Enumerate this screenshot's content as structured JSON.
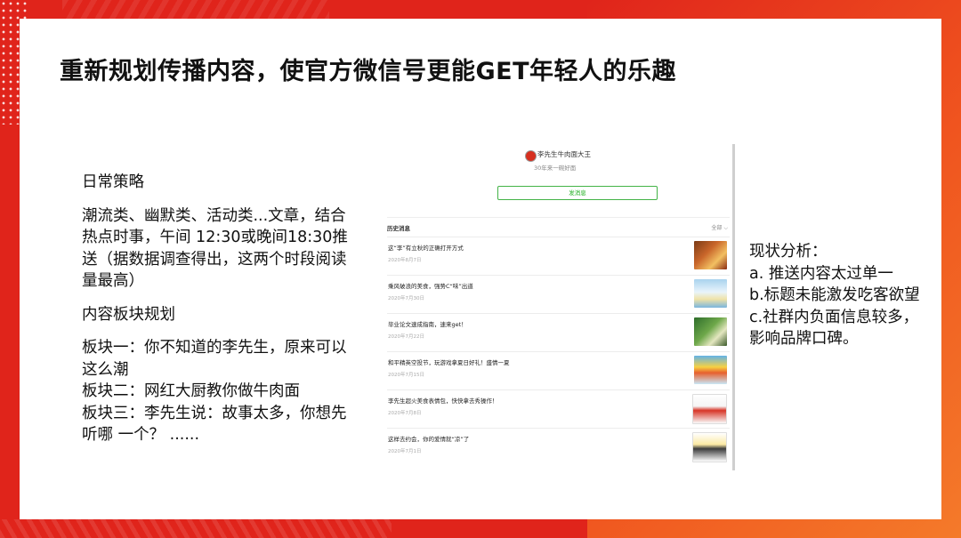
{
  "slide": {
    "title": "重新规划传播内容，使官方微信号更能GET年轻人的乐趣",
    "left": {
      "heading1": "日常策略",
      "para1": "潮流类、幽默类、活动类...文章，结合热点时事，午间 12:30或晚间18:30推送（据数据调查得出，这两个时段阅读量最高）",
      "heading2": "内容板块规划",
      "block1": "板块一：你不知道的李先生，原来可以这么潮",
      "block2": "板块二：网红大厨教你做牛肉面",
      "block3": "板块三：李先生说：故事太多，你想先听哪 一个？ ......"
    },
    "right": {
      "heading": "现状分析：",
      "item_a": "a. 推送内容太过单一",
      "item_b": "b.标题未能激发吃客欲望",
      "item_c": "c.社群内负面信息较多， 影响品牌口碑。"
    }
  },
  "wechat": {
    "account_name": "李先生牛肉面大王",
    "account_sub": "30年来一碗好面",
    "send_button": "发消息",
    "history_label": "历史消息",
    "history_all": "全部",
    "messages": [
      {
        "title": "这“李”有立秋的正确打开方式",
        "date": "2020年8月7日",
        "thumb": "food-photo"
      },
      {
        "title": "乘风破浪的美食，强势C“味”出道",
        "date": "2020年7月30日",
        "thumb": "cartoon-banner"
      },
      {
        "title": "毕业论文速成指南，速来get！",
        "date": "2020年7月22日",
        "thumb": "chalkboard-cartoon"
      },
      {
        "title": "和平精英空投节，玩游戏拿夏日好礼！盛情一夏",
        "date": "2020年7月15日",
        "thumb": "game-poster"
      },
      {
        "title": "李先生超火美食表情包，快快拿去秀操作！",
        "date": "2020年7月8日",
        "thumb": "sticker-text"
      },
      {
        "title": "这样去约会，你的爱情就“凉”了",
        "date": "2020年7月1日",
        "thumb": "comic-figure"
      }
    ]
  }
}
